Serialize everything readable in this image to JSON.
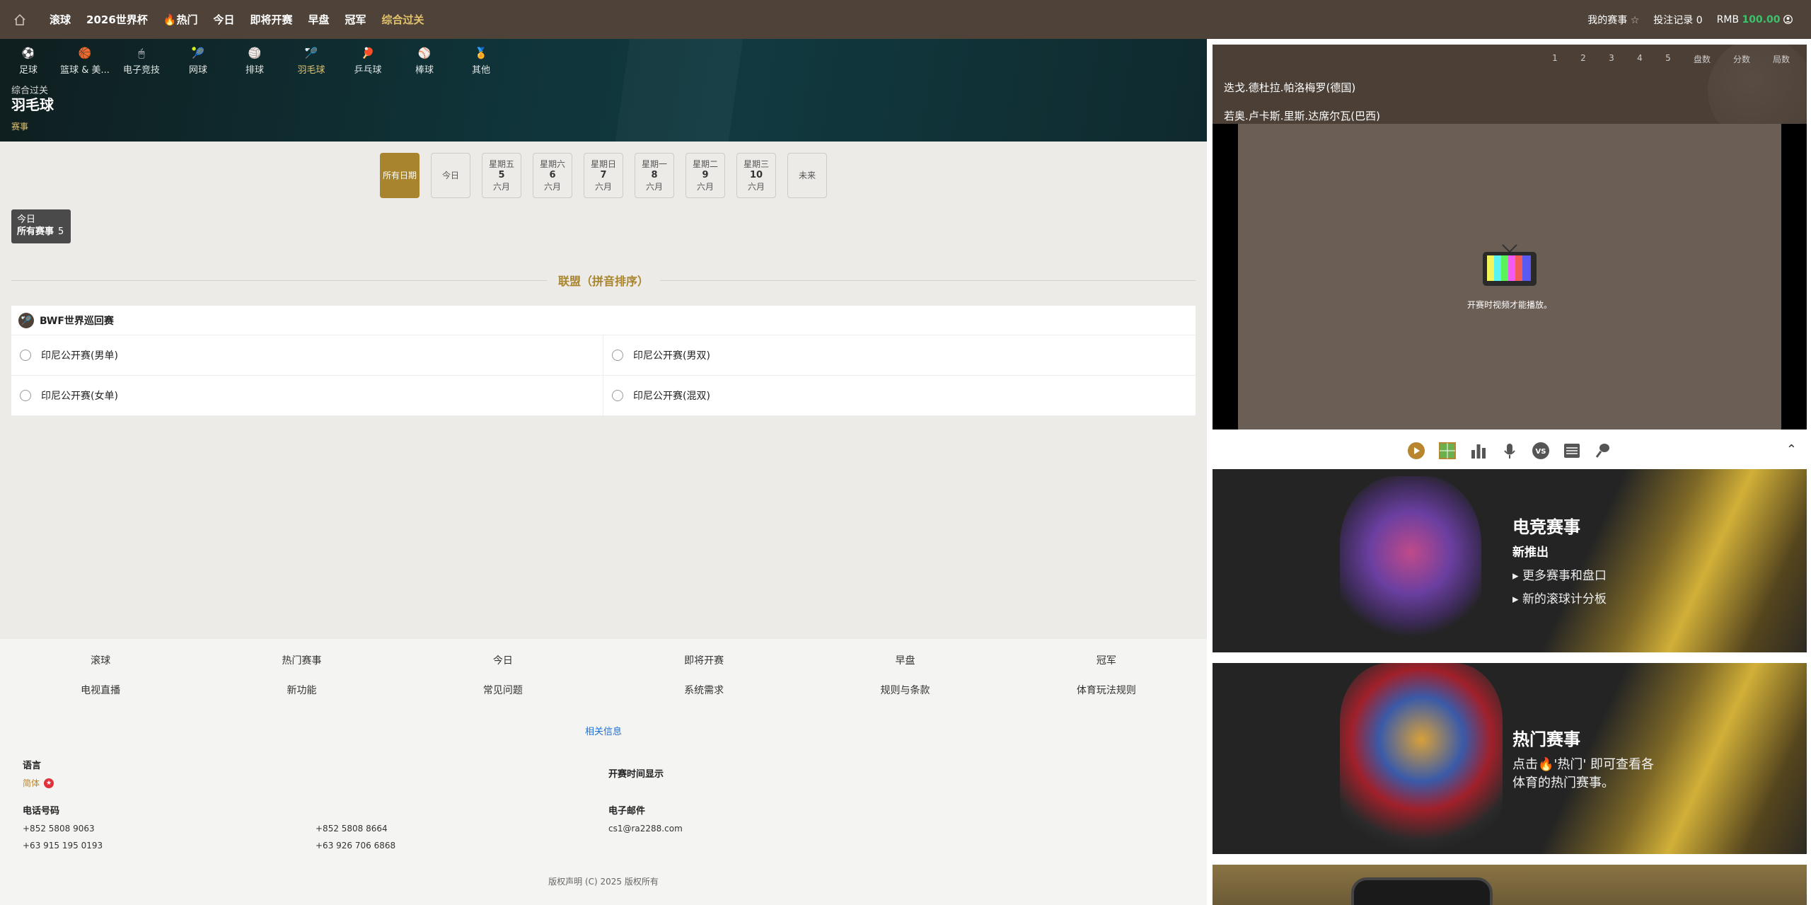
{
  "topnav": {
    "items": [
      "滚球",
      "2026世界杯",
      "热门",
      "今日",
      "即将开赛",
      "早盘",
      "冠军",
      "综合过关"
    ],
    "active": "综合过关",
    "my_events": "我的赛事",
    "bet_records": "投注记录",
    "bet_count": "0",
    "currency": "RMB",
    "balance": "100.00"
  },
  "sports": {
    "items": [
      {
        "label": "足球",
        "icon": "soccer-icon"
      },
      {
        "label": "篮球 & 美...",
        "icon": "basketball-icon"
      },
      {
        "label": "电子竞技",
        "icon": "esports-icon"
      },
      {
        "label": "网球",
        "icon": "tennis-icon"
      },
      {
        "label": "排球",
        "icon": "volleyball-icon"
      },
      {
        "label": "羽毛球",
        "icon": "badminton-icon"
      },
      {
        "label": "乒乓球",
        "icon": "table-tennis-icon"
      },
      {
        "label": "棒球",
        "icon": "baseball-icon"
      },
      {
        "label": "其他",
        "icon": "other-icon"
      }
    ],
    "active": "羽毛球",
    "breadcrumb": "综合过关",
    "title": "羽毛球",
    "subtab": "赛事"
  },
  "dates": [
    {
      "top": "所有日期",
      "day": "",
      "month": ""
    },
    {
      "top": "今日",
      "day": "",
      "month": ""
    },
    {
      "top": "星期五",
      "day": "5",
      "month": "六月"
    },
    {
      "top": "星期六",
      "day": "6",
      "month": "六月"
    },
    {
      "top": "星期日",
      "day": "7",
      "month": "六月"
    },
    {
      "top": "星期一",
      "day": "8",
      "month": "六月"
    },
    {
      "top": "星期二",
      "day": "9",
      "month": "六月"
    },
    {
      "top": "星期三",
      "day": "10",
      "month": "六月"
    },
    {
      "top": "未来",
      "day": "",
      "month": ""
    }
  ],
  "today_filter": {
    "line1": "今日",
    "line2": "所有赛事",
    "count": "5"
  },
  "league_sort_title": "联盟（拼音排序）",
  "league": {
    "name": "BWF世界巡回赛",
    "events": [
      "印尼公开赛(男单)",
      "印尼公开赛(男双)",
      "印尼公开赛(女单)",
      "印尼公开赛(混双)"
    ]
  },
  "footer": {
    "links": [
      "滚球",
      "热门赛事",
      "今日",
      "即将开赛",
      "早盘",
      "冠军",
      "电视直播",
      "新功能",
      "常见问题",
      "系统需求",
      "规则与条款",
      "体育玩法规则"
    ],
    "related": "相关信息",
    "language_label": "语言",
    "language_value": "简体",
    "kickoff_label": "开赛时间显示",
    "phone_label": "电话号码",
    "phones": [
      "+852 5808 9063",
      "+852 5808 8664",
      "+63 915 195 0193",
      "+63 926 706 6868"
    ],
    "email_label": "电子邮件",
    "email": "cs1@ra2288.com",
    "copyright": "版权声明 (C) 2025 版权所有"
  },
  "scoreboard": {
    "columns": [
      "1",
      "2",
      "3",
      "4",
      "5",
      "盘数",
      "分数",
      "局数"
    ],
    "player1": "迭戈.德杜拉.帕洛梅罗(德国)",
    "player2": "若奥.卢卡斯.里斯.达席尔瓦(巴西)"
  },
  "video": {
    "message": "开赛时视频才能播放。"
  },
  "banners": {
    "esports": {
      "title": "电竞赛事",
      "subtitle": "新推出",
      "points": [
        "更多赛事和盘口",
        "新的滚球计分板"
      ]
    },
    "hot": {
      "title": "热门赛事",
      "text1": "点击",
      "text2": "'热门' 即可查看各",
      "text3": "体育的热门赛事。"
    }
  },
  "colors": {
    "topbar": "#4f4339",
    "accent": "#a8852d",
    "gold": "#e2c36b",
    "balance": "#3ac36b"
  }
}
